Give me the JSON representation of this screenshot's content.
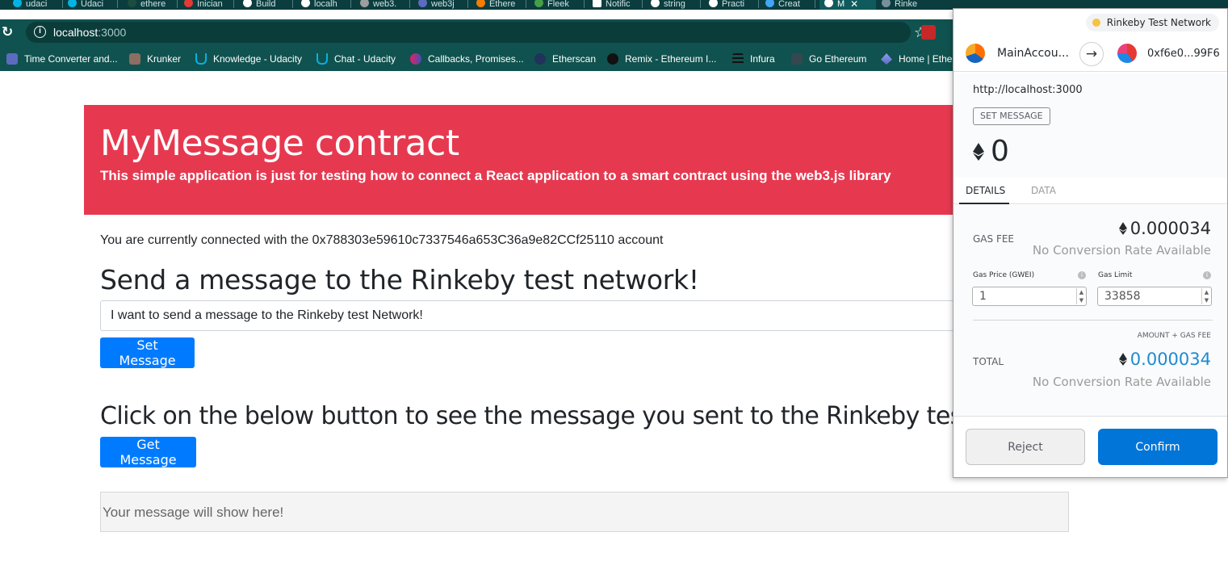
{
  "browser": {
    "tabs": [
      {
        "label": "udaci",
        "icon": "udacity-icon"
      },
      {
        "label": "Udaci",
        "icon": "udacity-icon"
      },
      {
        "label": "ethere",
        "icon": "favicon-icon"
      },
      {
        "label": "Inician",
        "icon": "favicon-icon"
      },
      {
        "label": "Build",
        "icon": "medium-icon"
      },
      {
        "label": "localh",
        "icon": "metamask-icon"
      },
      {
        "label": "web3.",
        "icon": "favicon-icon"
      },
      {
        "label": "web3j",
        "icon": "favicon-icon"
      },
      {
        "label": "Ethere",
        "icon": "favicon-icon"
      },
      {
        "label": "Fleek",
        "icon": "favicon-icon"
      },
      {
        "label": "Notific",
        "icon": "linkedin-icon"
      },
      {
        "label": "string",
        "icon": "google-icon"
      },
      {
        "label": "Practi",
        "icon": "medium-icon"
      },
      {
        "label": "Creat",
        "icon": "favicon-icon"
      },
      {
        "label": "M",
        "icon": "metamask-icon",
        "active": true
      },
      {
        "label": "Rinke",
        "icon": "favicon-icon"
      }
    ],
    "url_host": "localhost",
    "url_port": ":3000",
    "bookmarks": [
      "Time Converter and...",
      "Krunker",
      "Knowledge - Udacity",
      "Chat - Udacity",
      "Callbacks, Promises...",
      "Etherscan",
      "Remix - Ethereum I...",
      "Infura",
      "Go Ethereum",
      "Home | Ether"
    ]
  },
  "page": {
    "title": "MyMessage contract",
    "subtitle": "This simple application is just for testing how to connect a React application to a smart contract using the web3.js library",
    "connected_text": "You are currently connected with the 0x788303e59610c7337546a653C36a9e82CCf25110 account",
    "send_heading": "Send a message to the Rinkeby test network!",
    "message_input_value": "I want to send a message to the Rinkeby test Network!",
    "set_button": "Set Message",
    "get_heading": "Click on the below button to see the message you sent to the Rinkeby testnet",
    "get_button": "Get Message",
    "result_text": "Your message will show here!",
    "colors": {
      "jumbotron": "#e63950",
      "button": "#007bff"
    }
  },
  "metamask": {
    "network": "Rinkeby Test Network",
    "from_account": "MainAccou...",
    "to_account": "0xf6e0...99F6",
    "origin": "http://localhost:3000",
    "action_badge": "SET MESSAGE",
    "amount": "0",
    "tabs": [
      "DETAILS",
      "DATA"
    ],
    "gas_fee_label": "GAS FEE",
    "gas_fee_value": "0.000034",
    "no_conversion": "No Conversion Rate Available",
    "gas_price_label": "Gas Price (GWEI)",
    "gas_price_value": "1",
    "gas_limit_label": "Gas Limit",
    "gas_limit_value": "33858",
    "amount_gas_label": "AMOUNT + GAS FEE",
    "total_label": "TOTAL",
    "total_value": "0.000034",
    "reject_button": "Reject",
    "confirm_button": "Confirm"
  }
}
